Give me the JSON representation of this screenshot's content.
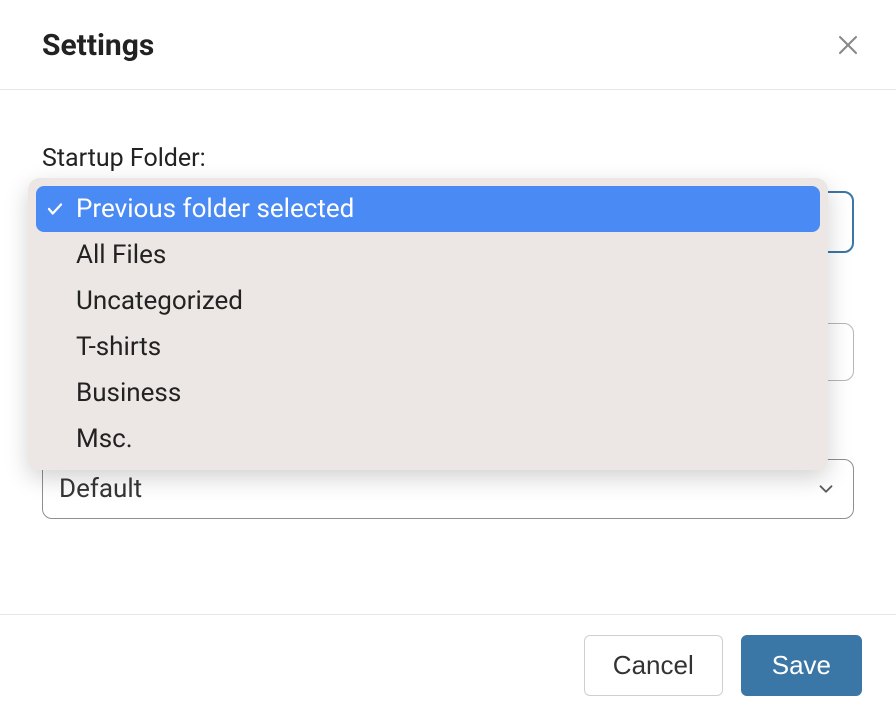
{
  "header": {
    "title": "Settings",
    "close_icon_name": "close-icon"
  },
  "form": {
    "startup_folder_label": "Startup Folder:",
    "dropdown_options": [
      {
        "label": "Previous folder selected",
        "selected": true
      },
      {
        "label": "All Files",
        "selected": false
      },
      {
        "label": "Uncategorized",
        "selected": false
      },
      {
        "label": "T-shirts",
        "selected": false
      },
      {
        "label": "Business",
        "selected": false
      },
      {
        "label": "Msc.",
        "selected": false
      }
    ],
    "visible_select_value": "Default"
  },
  "footer": {
    "cancel_label": "Cancel",
    "save_label": "Save"
  },
  "colors": {
    "accent": "#3a76a6",
    "dropdown_highlight": "#4a8af4",
    "dropdown_bg": "#ece7e4"
  }
}
